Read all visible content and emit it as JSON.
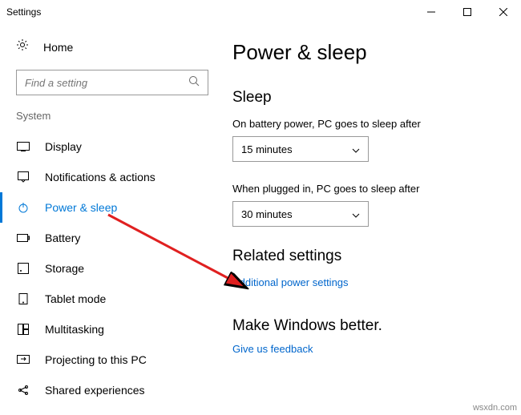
{
  "window": {
    "title": "Settings"
  },
  "sidebar": {
    "home": "Home",
    "search_placeholder": "Find a setting",
    "group": "System",
    "items": [
      {
        "label": "Display"
      },
      {
        "label": "Notifications & actions"
      },
      {
        "label": "Power & sleep"
      },
      {
        "label": "Battery"
      },
      {
        "label": "Storage"
      },
      {
        "label": "Tablet mode"
      },
      {
        "label": "Multitasking"
      },
      {
        "label": "Projecting to this PC"
      },
      {
        "label": "Shared experiences"
      }
    ]
  },
  "main": {
    "title": "Power & sleep",
    "sleep": {
      "heading": "Sleep",
      "battery_label": "On battery power, PC goes to sleep after",
      "battery_value": "15 minutes",
      "plugged_label": "When plugged in, PC goes to sleep after",
      "plugged_value": "30 minutes"
    },
    "related": {
      "heading": "Related settings",
      "link": "Additional power settings"
    },
    "better": {
      "heading": "Make Windows better.",
      "link": "Give us feedback"
    }
  },
  "watermark": "wsxdn.com"
}
